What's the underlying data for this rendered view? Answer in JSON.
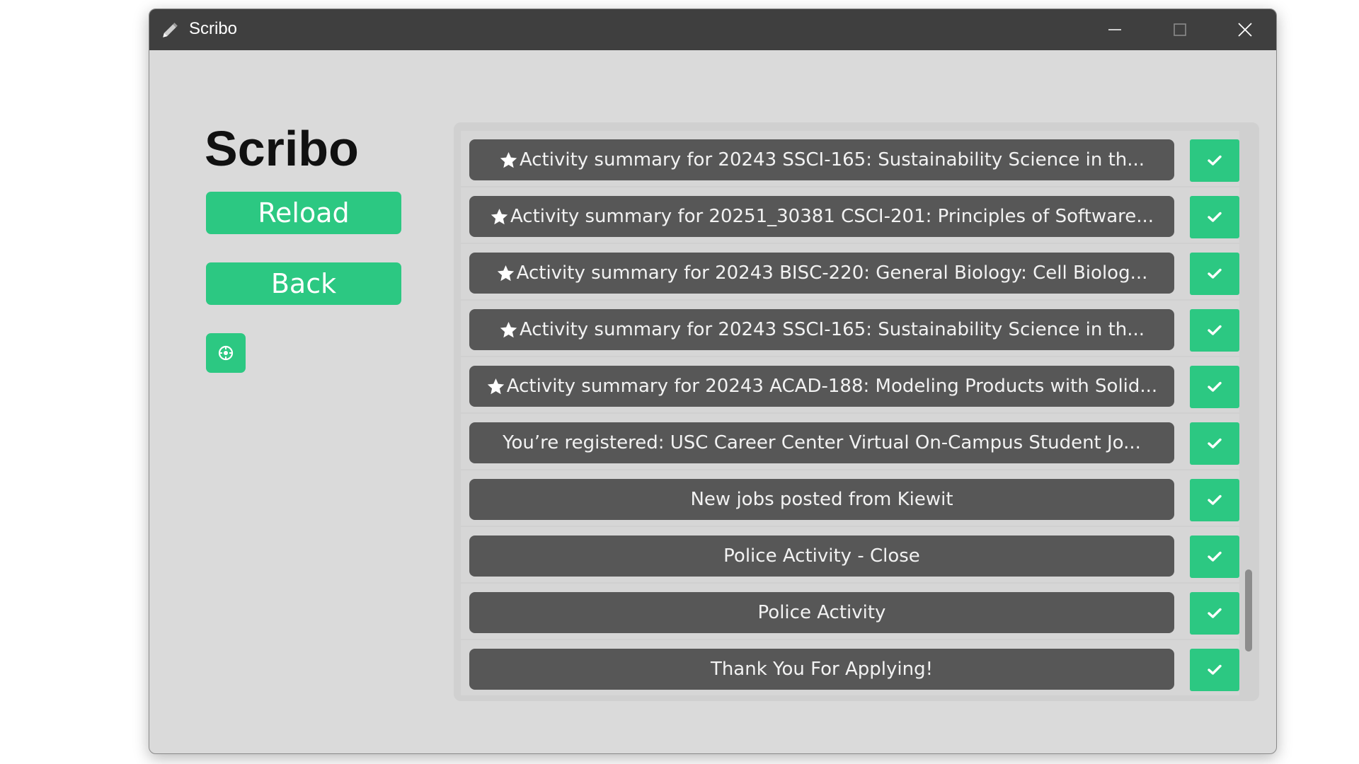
{
  "window": {
    "title": "Scribo",
    "icon": "pencil-icon",
    "controls": [
      "minimize-icon",
      "maximize-icon",
      "close-icon"
    ]
  },
  "sidebar": {
    "app_title": "Scribo",
    "reload_label": "Reload",
    "back_label": "Back",
    "settings_icon": "settings-icon"
  },
  "colors": {
    "accent": "#2cc882",
    "titlebar": "#3f3f3f",
    "window_bg": "#dadada",
    "item_bg": "#575757"
  },
  "emails": [
    {
      "starred": true,
      "subject": "Activity summary for 20243 SSCI-165: Sustainability Science in th..."
    },
    {
      "starred": true,
      "subject": "Activity summary for 20251_30381 CSCI-201: Principles of Software..."
    },
    {
      "starred": true,
      "subject": "Activity summary for 20243 BISC-220: General Biology: Cell Biolog..."
    },
    {
      "starred": true,
      "subject": "Activity summary for 20243 SSCI-165: Sustainability Science in th..."
    },
    {
      "starred": true,
      "subject": "Activity summary for 20243 ACAD-188: Modeling Products with Solid..."
    },
    {
      "starred": false,
      "subject": "You’re registered: USC Career Center Virtual On-Campus Student Jo..."
    },
    {
      "starred": false,
      "subject": "New jobs posted from Kiewit"
    },
    {
      "starred": false,
      "subject": "Police Activity - Close"
    },
    {
      "starred": false,
      "subject": "Police Activity"
    },
    {
      "starred": false,
      "subject": "Thank You For Applying!"
    }
  ]
}
